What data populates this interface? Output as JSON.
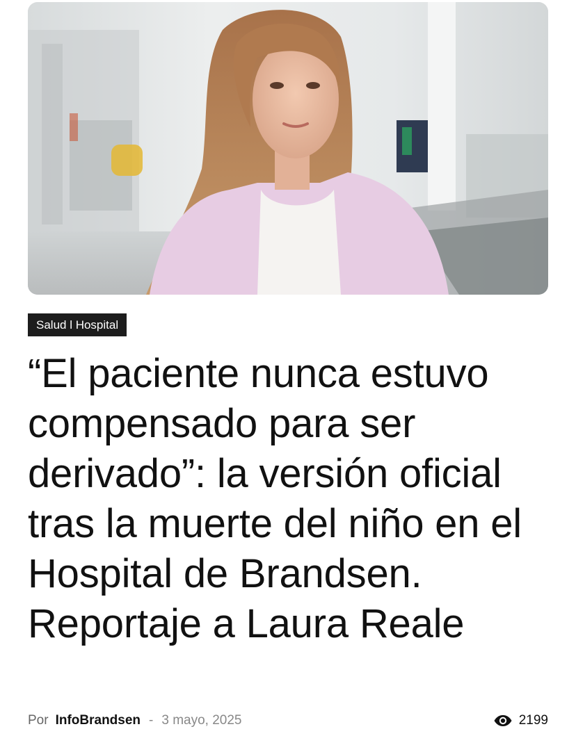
{
  "article": {
    "category": "Salud l Hospital",
    "headline": "“El paciente nunca estuvo compensado para ser derivado”: la versión oficial tras la muerte del niño en el Hospital de Brandsen. Reportaje a Laura Reale",
    "byline_prefix": "Por",
    "author": "InfoBrandsen",
    "separator": "-",
    "date": "3 mayo, 2025",
    "views": "2199",
    "views_icon": "eye-icon"
  }
}
